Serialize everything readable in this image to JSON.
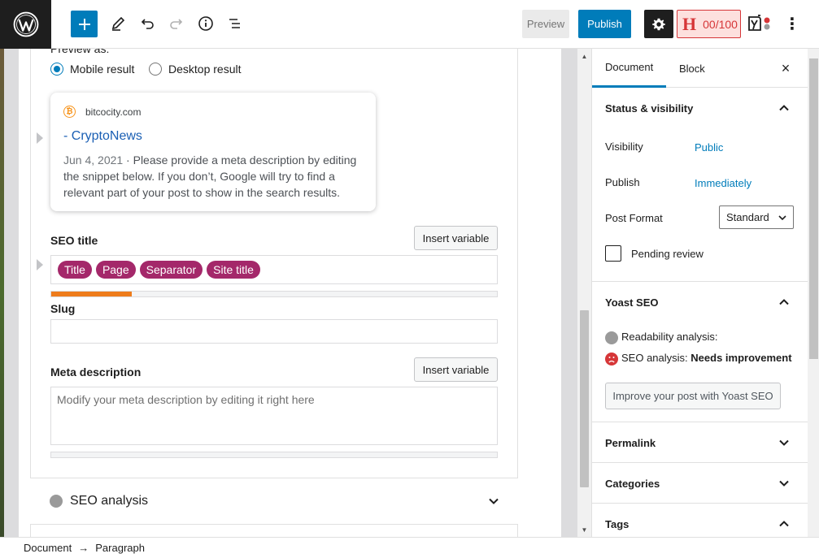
{
  "toolbar": {
    "preview_label": "Preview",
    "publish_label": "Publish",
    "hemingway_letter": "H",
    "hemingway_score": "00/100",
    "more_label": "⋮"
  },
  "editor": {
    "preview_as_label": "Preview as:",
    "mobile_result_label": "Mobile result",
    "desktop_result_label": "Desktop result",
    "serp": {
      "site": "bitcocity.com",
      "title": "- CryptoNews",
      "date": "Jun 4, 2021",
      "description": " · Please provide a meta description by editing the snippet below. If you don’t, Google will try to find a relevant part of your post to show in the search results."
    },
    "seo_title_label": "SEO title",
    "insert_variable_label": "Insert variable",
    "title_pills": [
      "Title",
      "Page",
      "Separator",
      "Site title"
    ],
    "seo_title_progress": 0.18,
    "slug_label": "Slug",
    "slug_value": "",
    "meta_description_label": "Meta description",
    "meta_description_placeholder": "Modify your meta description by editing it right here",
    "meta_description_progress": 0,
    "seo_analysis_label": "SEO analysis"
  },
  "sidebar": {
    "tabs": [
      "Document",
      "Block"
    ],
    "active_tab": "Document",
    "close_label": "×",
    "status_visibility": {
      "title": "Status & visibility",
      "visibility_label": "Visibility",
      "visibility_value": "Public",
      "publish_label": "Publish",
      "publish_value": "Immediately",
      "post_format_label": "Post Format",
      "post_format_value": "Standard",
      "pending_review_label": "Pending review",
      "pending_review_checked": false
    },
    "yoast": {
      "title": "Yoast SEO",
      "readability_label": "Readability analysis:",
      "seo_label": "SEO analysis:",
      "seo_value": "Needs improvement",
      "improve_button": "Improve your post with Yoast SEO"
    },
    "permalink_label": "Permalink",
    "categories_label": "Categories",
    "tags_label": "Tags"
  },
  "footer": {
    "crumbs": [
      "Document",
      "Paragraph"
    ],
    "separator": "→"
  },
  "colors": {
    "accent": "#007cba",
    "pill": "#a4286a",
    "progress": "#ee7c1b",
    "error": "#d63638"
  }
}
